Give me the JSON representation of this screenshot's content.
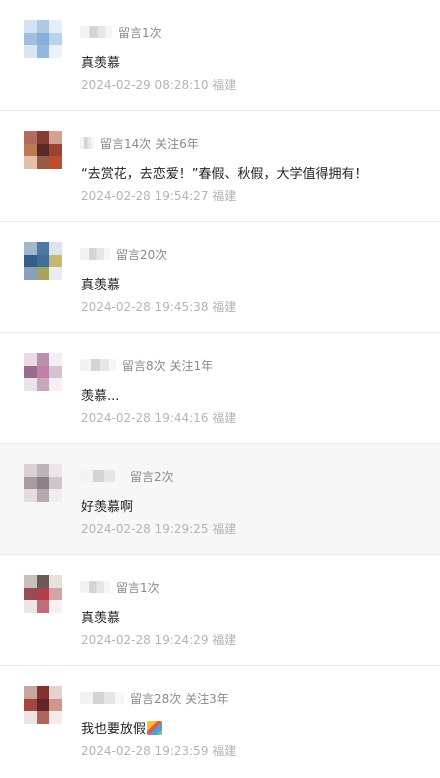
{
  "comments": [
    {
      "stats": "留言1次",
      "content": "真羡慕",
      "time": "2024-02-29 08:28:10 福建",
      "highlight": false,
      "avatar_colors": [
        "#cfe3f5",
        "#a9c9ea",
        "#e3eef9",
        "#9cc0e4",
        "#7fb0de",
        "#b9d4ef",
        "#d8e7f6",
        "#8cb8e1",
        "#eaf2fa"
      ]
    },
    {
      "stats": "留言14次 关注6年",
      "content": "“去赏花，去恋爱！”春假、秋假，大学值得拥有！",
      "time": "2024-02-28 19:54:27 福建",
      "highlight": false,
      "avatar_colors": [
        "#b86a5c",
        "#8a3b33",
        "#d8a18e",
        "#c07a4e",
        "#5a2a22",
        "#a8402e",
        "#e4c0a8",
        "#9c5a40",
        "#c84a2c"
      ]
    },
    {
      "stats": "留言20次",
      "content": "真羡慕",
      "time": "2024-02-28 19:45:38 福建",
      "highlight": false,
      "avatar_colors": [
        "#9fb8cf",
        "#4a79a8",
        "#dbe4ec",
        "#2e5f8c",
        "#3e6e9e",
        "#c7b86a",
        "#87a2bb",
        "#a8a458",
        "#e8edf2"
      ]
    },
    {
      "stats": "留言8次 关注1年",
      "content": "羡慕...",
      "time": "2024-02-28 19:44:16 福建",
      "highlight": false,
      "avatar_colors": [
        "#e8dce6",
        "#b98fb0",
        "#f3eef2",
        "#9e6a8e",
        "#c47fa8",
        "#d8c0d2",
        "#ede3ea",
        "#c9a6bd",
        "#f5f0f4"
      ]
    },
    {
      "stats": "留言2次",
      "content": "好羡慕啊",
      "time": "2024-02-28 19:29:25 福建",
      "highlight": true,
      "avatar_colors": [
        "#d9d2d6",
        "#bfb3ba",
        "#ece6ea",
        "#a89aa3",
        "#8e8089",
        "#cfc6cc",
        "#e3dde1",
        "#b5a9b0",
        "#f0ecef"
      ]
    },
    {
      "stats": "留言1次",
      "content": "真羡慕",
      "time": "2024-02-28 19:24:29 福建",
      "highlight": false,
      "avatar_colors": [
        "#c8c0bd",
        "#6a5a58",
        "#e9e2df",
        "#9c4a52",
        "#b83c4a",
        "#d6a3aa",
        "#efe6e4",
        "#c86a78",
        "#f6f0ee"
      ]
    },
    {
      "stats": "留言28次 关注3年",
      "content": "我也要放假",
      "time": "2024-02-28 19:23:59 福建",
      "highlight": false,
      "emoji": "party-emoji",
      "avatar_colors": [
        "#caa39a",
        "#8c2f2f",
        "#e6d2cd",
        "#a8463e",
        "#6a2222",
        "#d69488",
        "#efe4e1",
        "#b8645a",
        "#f5ecea"
      ]
    }
  ]
}
